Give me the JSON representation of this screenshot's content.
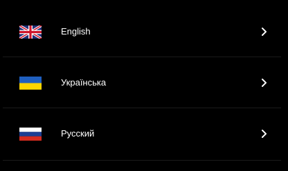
{
  "languages": [
    {
      "label": "English",
      "flag_icon": "uk-flag-icon",
      "chevron_icon": "chevron-right-icon"
    },
    {
      "label": "Українська",
      "flag_icon": "ukraine-flag-icon",
      "chevron_icon": "chevron-right-icon"
    },
    {
      "label": "Русский",
      "flag_icon": "russia-flag-icon",
      "chevron_icon": "chevron-right-icon"
    }
  ],
  "colors": {
    "background": "#000000",
    "text": "#ffffff",
    "divider": "#1b1b1b"
  }
}
